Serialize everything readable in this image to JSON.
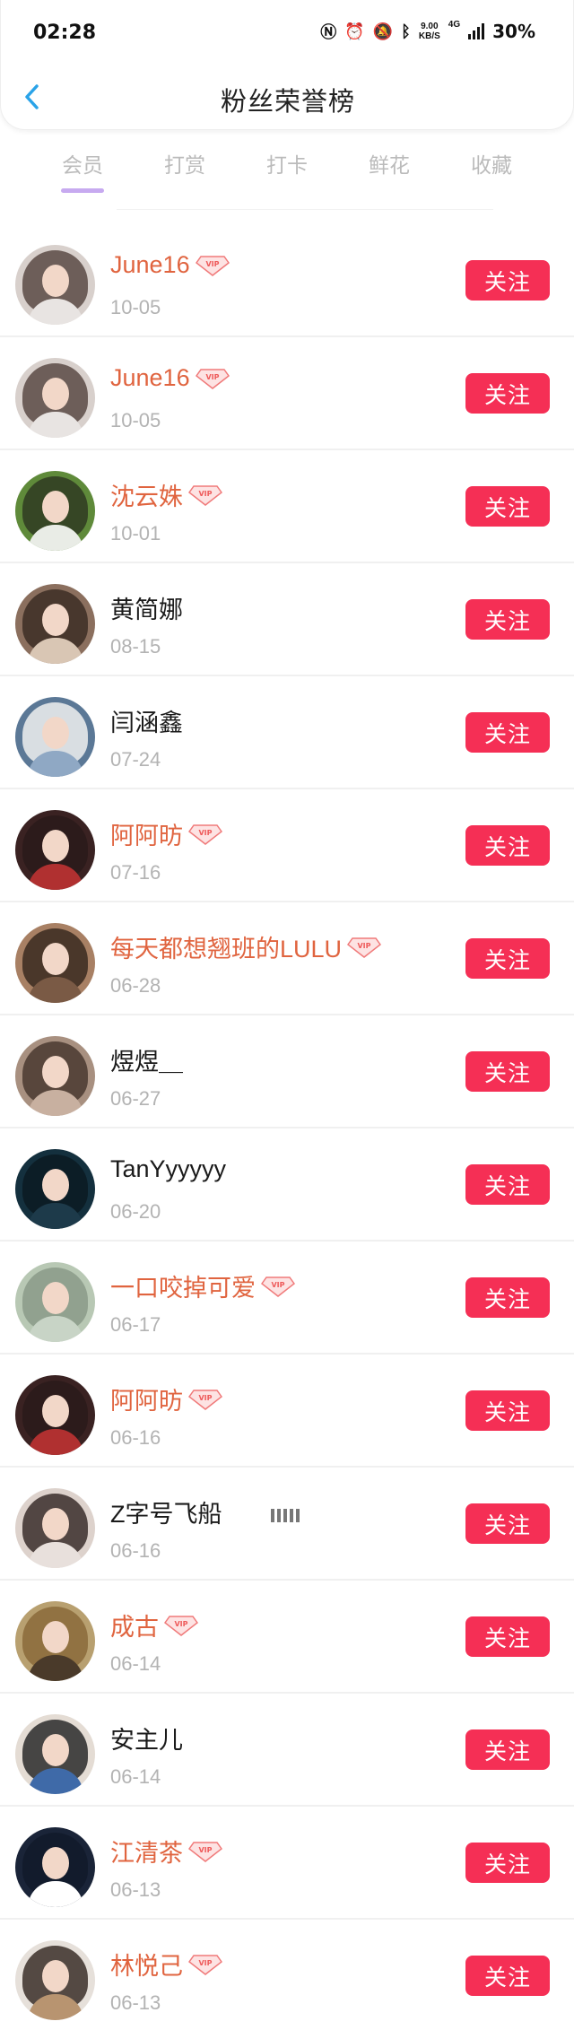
{
  "status_bar": {
    "time": "02:28",
    "net_speed_value": "9.00",
    "net_speed_unit": "KB/S",
    "network": "4G",
    "battery": "30%"
  },
  "header": {
    "title": "粉丝荣誉榜"
  },
  "tabs": [
    {
      "label": "会员",
      "active": true
    },
    {
      "label": "打赏",
      "active": false
    },
    {
      "label": "打卡",
      "active": false
    },
    {
      "label": "鲜花",
      "active": false
    },
    {
      "label": "收藏",
      "active": false
    }
  ],
  "follow_label": "关注",
  "colors": {
    "accent": "#f52f55",
    "vip_name": "#e0643f",
    "tab_active": "#b69de0",
    "date": "#b3b3b3"
  },
  "vip_badge_text": "VIP",
  "fans": [
    {
      "name": "June16",
      "date": "10-05",
      "vip": true,
      "hair": "#5a4a44",
      "body": "#e8e4e2",
      "bg": "#d8d0cc"
    },
    {
      "name": "June16",
      "date": "10-05",
      "vip": true,
      "hair": "#5a4a44",
      "body": "#e8e4e2",
      "bg": "#d8d0cc"
    },
    {
      "name": "沈云姝",
      "date": "10-01",
      "vip": true,
      "hair": "#2f3a22",
      "body": "#e9ece6",
      "bg": "#5f8a3a"
    },
    {
      "name": "黄简娜",
      "date": "08-15",
      "vip": false,
      "hair": "#3c2e25",
      "body": "#d9c6b4",
      "bg": "#8b6f5e"
    },
    {
      "name": "闫涵鑫",
      "date": "07-24",
      "vip": false,
      "hair": "#f0f0f0",
      "body": "#8fa8c4",
      "bg": "#5b7896"
    },
    {
      "name": "阿阿昉",
      "date": "07-16",
      "vip": true,
      "hair": "#2a1a1a",
      "body": "#b03030",
      "bg": "#3a2222"
    },
    {
      "name": "每天都想翘班的LULU",
      "date": "06-28",
      "vip": true,
      "hair": "#3a2a20",
      "body": "#7a5a45",
      "bg": "#a88064"
    },
    {
      "name": "煜煜＿",
      "date": "06-27",
      "vip": false,
      "hair": "#4a3a30",
      "body": "#c8b0a0",
      "bg": "#a89080"
    },
    {
      "name": "TanYyyyyy",
      "date": "06-20",
      "vip": false,
      "hair": "#0a1a22",
      "body": "#1d3a4a",
      "bg": "#14303e"
    },
    {
      "name": "一口咬掉可爱",
      "date": "06-17",
      "vip": true,
      "hair": "#8a9a88",
      "body": "#c8d4c6",
      "bg": "#b8c8b4"
    },
    {
      "name": "阿阿昉",
      "date": "06-16",
      "vip": true,
      "hair": "#2a1a1a",
      "body": "#b03030",
      "bg": "#3a2222"
    },
    {
      "name": "Z字号飞船",
      "date": "06-16",
      "vip": false,
      "hair": "#3a2e2a",
      "body": "#e8e0dc",
      "bg": "#ddd2cc"
    },
    {
      "name": "成古",
      "date": "06-14",
      "vip": true,
      "hair": "#8a6a3a",
      "body": "#4a3a2a",
      "bg": "#b8a070"
    },
    {
      "name": "安主儿",
      "date": "06-14",
      "vip": false,
      "hair": "#2a2a2a",
      "body": "#3f6aa8",
      "bg": "#e4dcd4"
    },
    {
      "name": "江清茶",
      "date": "06-13",
      "vip": true,
      "hair": "#121a2a",
      "body": "#ffffff",
      "bg": "#1a2438"
    },
    {
      "name": "林悦己",
      "date": "06-13",
      "vip": true,
      "hair": "#3a2e28",
      "body": "#b89470",
      "bg": "#e6e0da"
    }
  ]
}
